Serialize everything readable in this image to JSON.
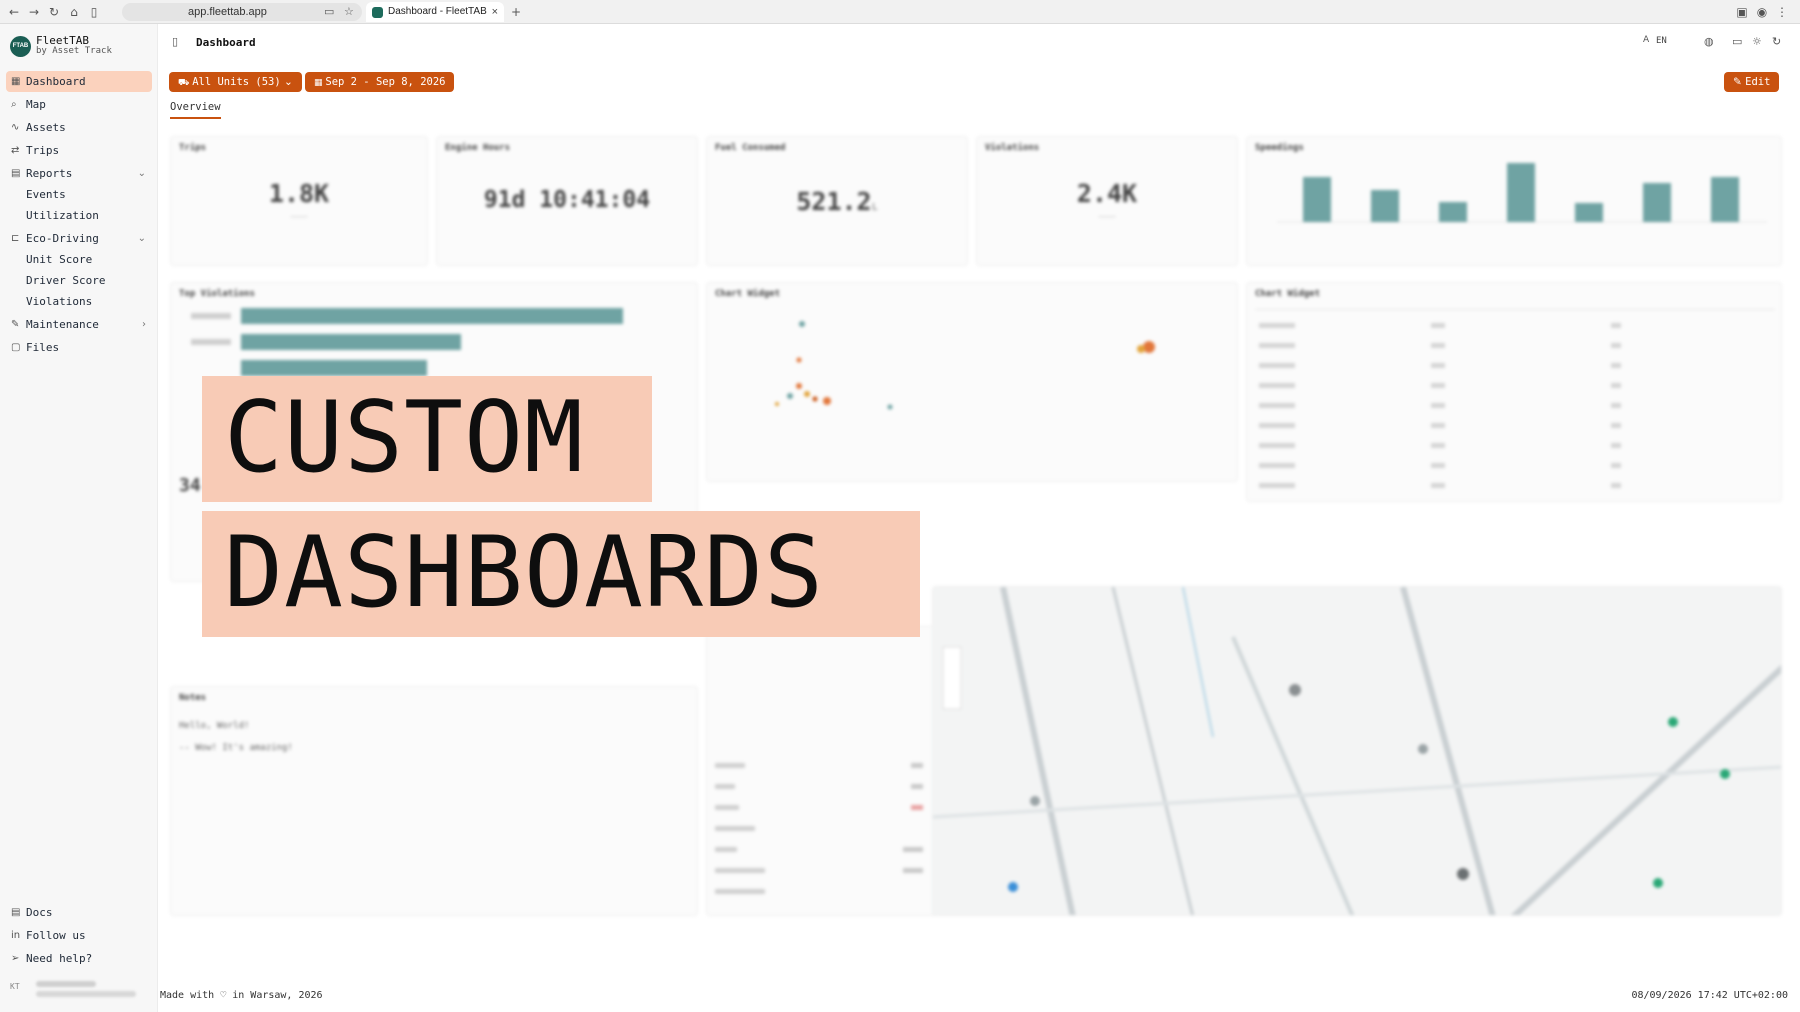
{
  "browser": {
    "url": "app.fleettab.app",
    "tab_title": "Dashboard - FleetTAB"
  },
  "brand": {
    "logo_text": "FTAB",
    "name": "FleetTAB",
    "sub": "by Asset Track"
  },
  "sidebar": {
    "items": [
      {
        "label": "Dashboard",
        "icon": "grid-icon"
      },
      {
        "label": "Map",
        "icon": "map-icon"
      },
      {
        "label": "Assets",
        "icon": "assets-icon"
      },
      {
        "label": "Trips",
        "icon": "route-icon"
      },
      {
        "label": "Reports",
        "icon": "report-icon"
      },
      {
        "label": "Eco-Driving",
        "icon": "leaf-icon"
      },
      {
        "label": "Maintenance",
        "icon": "wrench-icon"
      },
      {
        "label": "Files",
        "icon": "file-icon"
      }
    ],
    "report_sub": [
      "Events",
      "Utilization"
    ],
    "eco_sub": [
      "Unit Score",
      "Driver Score",
      "Violations"
    ],
    "bottom": [
      {
        "label": "Docs",
        "icon": "book-icon"
      },
      {
        "label": "Follow us",
        "icon": "linkedin-icon"
      },
      {
        "label": "Need help?",
        "icon": "send-icon"
      }
    ],
    "user_initials": "KT"
  },
  "header": {
    "title": "Dashboard",
    "lang": "EN"
  },
  "filters": {
    "units": "All Units (53)",
    "dates": "Sep 2 - Sep 8, 2026",
    "edit": "Edit"
  },
  "tabs": [
    "Overview"
  ],
  "widgets": {
    "trips": {
      "title": "Trips",
      "value": "1.8K"
    },
    "engine": {
      "title": "Engine Hours",
      "value": "91d 10:41:04"
    },
    "fuel": {
      "title": "Fuel Consumed",
      "value": "521.2",
      "unit": "L"
    },
    "violations": {
      "title": "Violations",
      "value": "2.4K"
    },
    "speedings": {
      "title": "Speedings"
    },
    "top_violations": {
      "title": "Top Violations"
    },
    "chart_widget_1": {
      "title": "Chart Widget"
    },
    "chart_widget_2": {
      "title": "Chart Widget"
    },
    "notes": {
      "title": "Notes",
      "line1": "Hello, World!",
      "line2": "-- Wow! It's amazing!"
    },
    "idle_value": "34"
  },
  "caption": {
    "line1": "CUSTOM",
    "line2": "DASHBOARDS"
  },
  "footer": {
    "left": "Made with ♡ in Warsaw, 2026",
    "right": "08/09/2026 17:42 UTC+02:00"
  },
  "colors": {
    "accent": "#c9520f",
    "active_bg": "#fbd2bd",
    "teal": "#6fa3a3",
    "caption_bg": "#f8cbb6"
  }
}
